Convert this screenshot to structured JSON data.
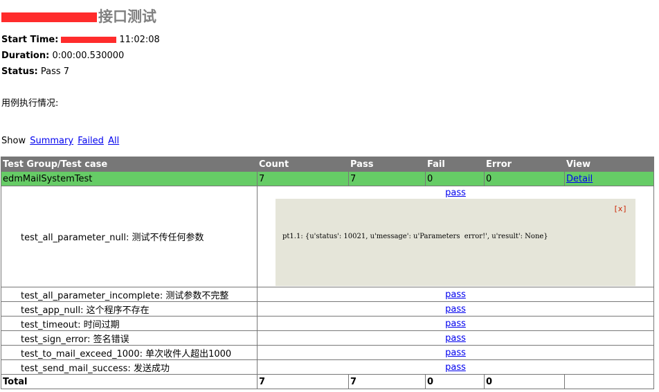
{
  "header": {
    "title_suffix": "接口测试",
    "start_time_label": "Start Time:",
    "start_time_value": "11:02:08",
    "duration_label": "Duration:",
    "duration_value": "0:00:00.530000",
    "status_label": "Status:",
    "status_value": "Pass 7",
    "description": "用例执行情况:"
  },
  "filter": {
    "label": "Show",
    "summary": "Summary",
    "failed": "Failed",
    "all": "All"
  },
  "table": {
    "columns": [
      "Test Group/Test case",
      "Count",
      "Pass",
      "Fail",
      "Error",
      "View"
    ],
    "group": {
      "name": "edmMailSystemTest",
      "count": "7",
      "pass": "7",
      "fail": "0",
      "error": "0",
      "view": "Detail"
    },
    "cases": [
      {
        "name": "test_all_parameter_null: 测试不传任何参数",
        "result": "pass"
      },
      {
        "name": "test_all_parameter_incomplete: 测试参数不完整",
        "result": "pass"
      },
      {
        "name": "test_app_null: 这个程序不存在",
        "result": "pass"
      },
      {
        "name": "test_timeout: 时间过期",
        "result": "pass"
      },
      {
        "name": "test_sign_error: 签名错误",
        "result": "pass"
      },
      {
        "name": "test_to_mail_exceed_1000: 单次收件人超出1000",
        "result": "pass"
      },
      {
        "name": "test_send_mail_success: 发送成功",
        "result": "pass"
      }
    ],
    "popup": {
      "close": "[x]",
      "output": "pt1.1: {u'status': 10021, u'message': u'Parameters  error!', u'result': None}"
    },
    "total": {
      "label": "Total",
      "count": "7",
      "pass": "7",
      "fail": "0",
      "error": "0"
    }
  },
  "colors": {
    "header_bg": "#777777",
    "group_bg": "#66cc66",
    "popup_bg": "#e5e5d9",
    "redaction": "#ff2c2c"
  }
}
